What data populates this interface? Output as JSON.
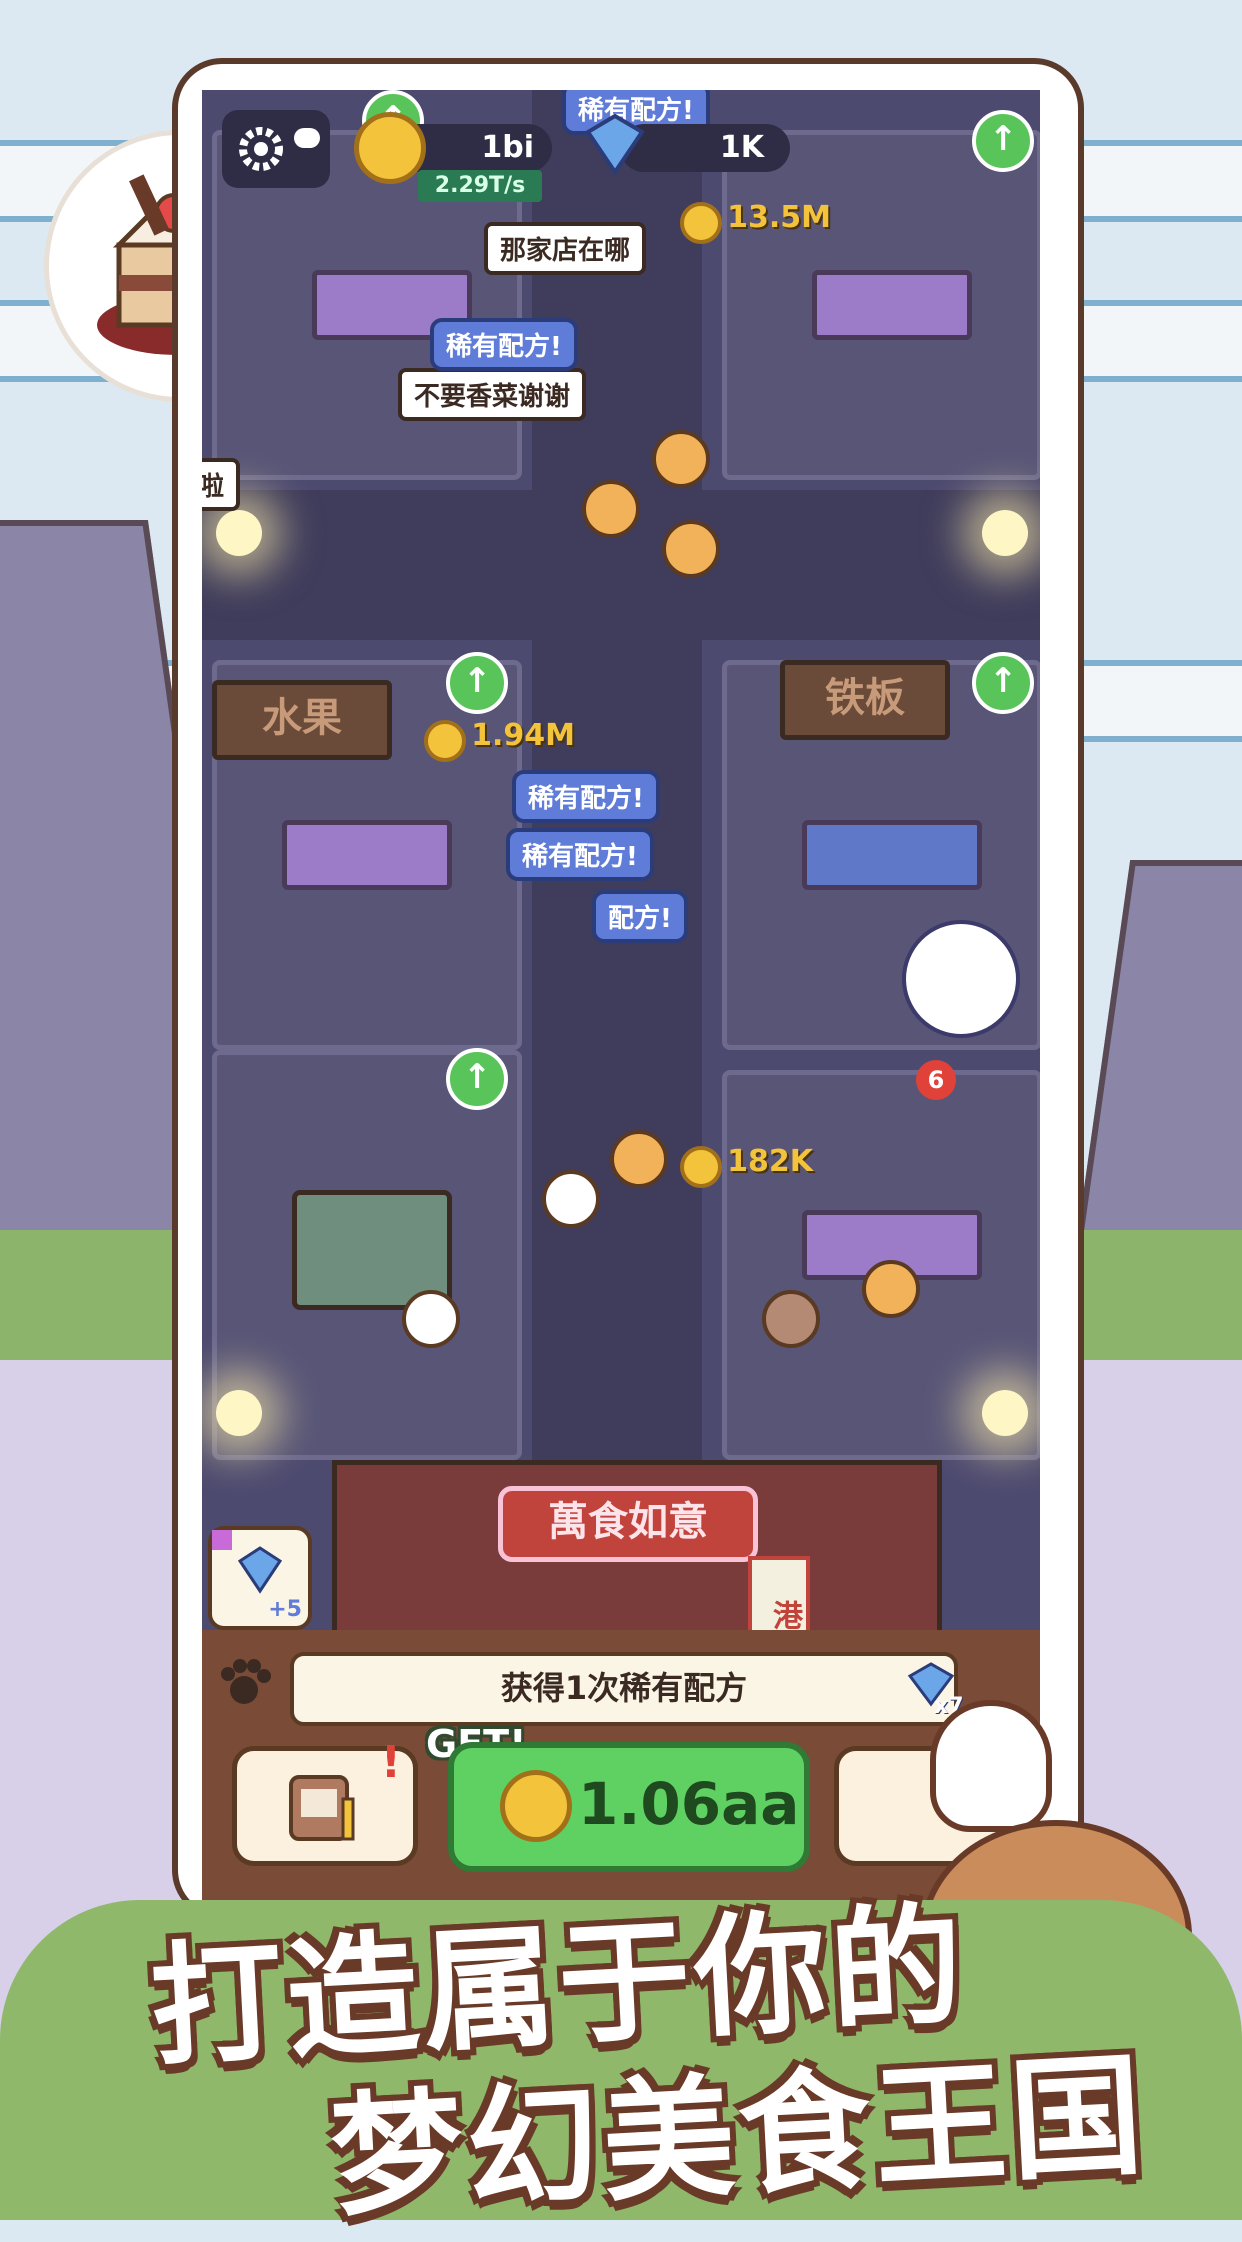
{
  "hud": {
    "cash_total": "1bi",
    "cash_rate": "2.29T/s",
    "gems": "1K"
  },
  "stall_earnings": {
    "top_center": "13.5M",
    "fruit": "1.94M",
    "lower_right": "182K"
  },
  "stall_signs": {
    "fruit": "水果",
    "iron_plate": "铁板",
    "gate": "萬食如意",
    "gate_side": "港式"
  },
  "bubbles": {
    "where_store": "那家店在哪",
    "no_cilantro": "不要香菜谢谢",
    "edge": "啦",
    "rare_recipe": "稀有配方!",
    "rare_partial": "配方!"
  },
  "badges": {
    "gem_bonus": "+5",
    "notice_gem_count": "x7",
    "queue_count": "6"
  },
  "bottom": {
    "notice": "获得1次稀有配方",
    "get_label": "GET!",
    "get_amount": "1.06aa"
  },
  "tagline": {
    "line1": "打造属于你的",
    "line2": "梦幻美食王国"
  },
  "colors": {
    "accent_green": "#5fd163",
    "gold": "#f4c33c",
    "rare_blue": "#5f7cd8",
    "outline_brown": "#6a3a28"
  },
  "icons": [
    "gear-icon",
    "cloud-sync-icon",
    "coin-icon",
    "gem-icon",
    "arrow-up-icon",
    "paw-icon",
    "recipe-book-icon",
    "cake-icon"
  ]
}
